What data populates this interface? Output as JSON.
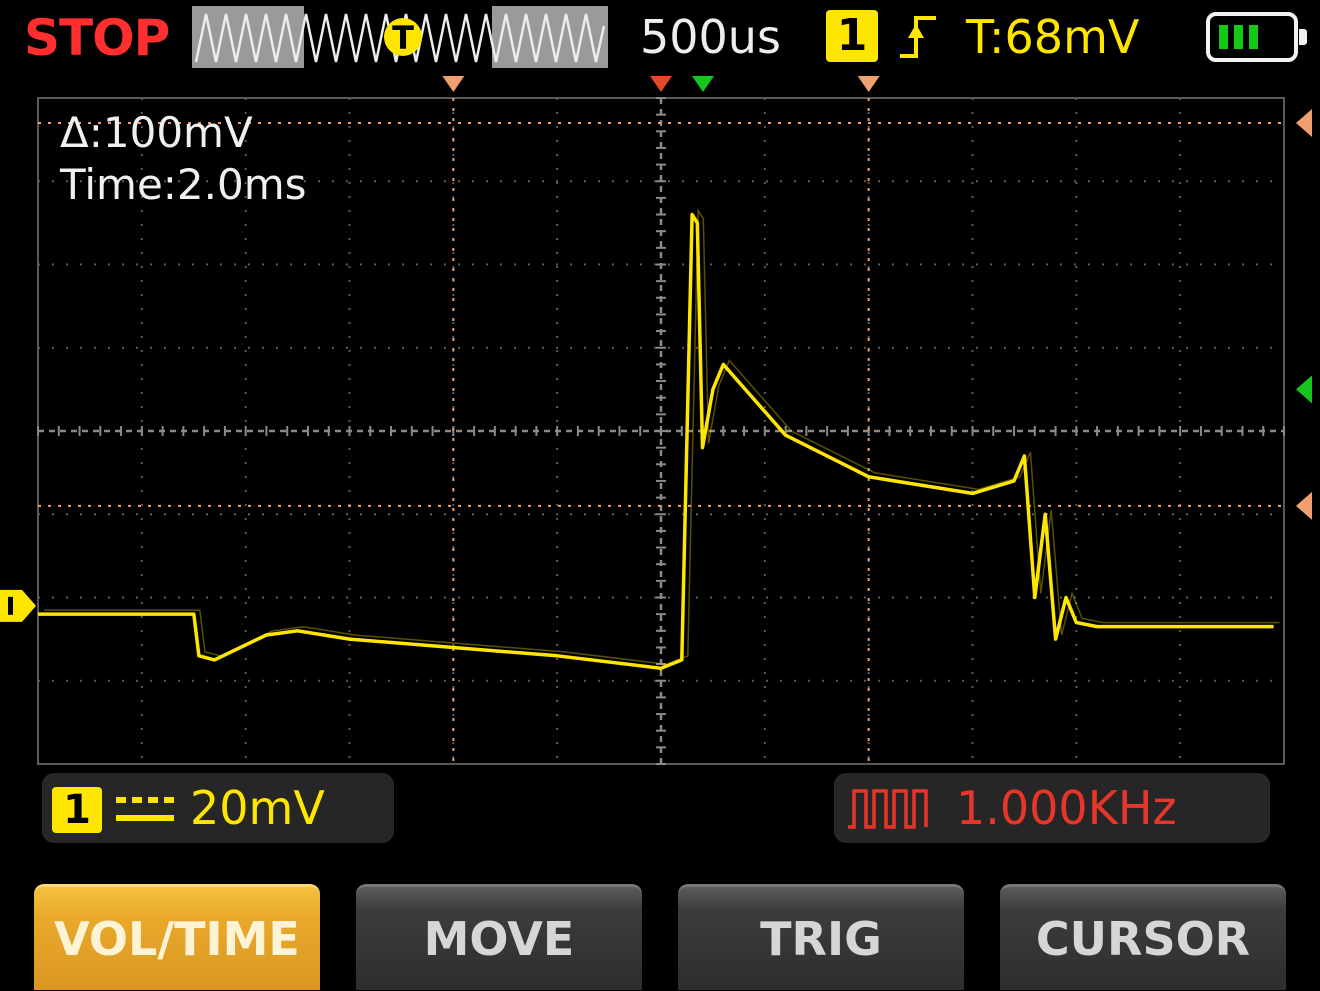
{
  "status": {
    "run_state": "STOP"
  },
  "overview": {
    "trigger_marker": "T"
  },
  "header": {
    "timebase": "500us",
    "channel": "1",
    "trigger_edge_icon": "rising-edge-icon",
    "trigger_level": "T:68mV",
    "battery_bars": 3
  },
  "readouts": {
    "delta": "Δ:100mV",
    "time": "Time:2.0ms"
  },
  "channel_info": {
    "channel": "1",
    "coupling_icon": "dc-coupling-icon",
    "volts_per_div": "20mV"
  },
  "frequency": {
    "icon": "square-wave-icon",
    "value": "1.000KHz"
  },
  "softkeys": [
    {
      "label": "VOL/TIME",
      "active": true
    },
    {
      "label": "MOVE",
      "active": false
    },
    {
      "label": "TRIG",
      "active": false
    },
    {
      "label": "CURSOR",
      "active": false
    }
  ],
  "colors": {
    "stop": "#ff2f2f",
    "channel1": "#ffe600",
    "cursor": "#f0a070",
    "trigger_pos": "#e04a2a",
    "center_marker": "#18c41e",
    "frequency": "#e8352a",
    "active_key": "#e9a92c"
  },
  "chart_data": {
    "type": "line",
    "x_divisions": 12,
    "y_divisions": 8,
    "grid": true,
    "series": [
      {
        "channel": "1",
        "x": [
          0,
          1.5,
          1.55,
          1.7,
          2.2,
          2.5,
          3,
          4,
          5,
          6,
          6.2,
          6.3,
          6.35,
          6.4,
          6.5,
          6.6,
          7.2,
          8,
          9,
          9.4,
          9.5,
          9.6,
          9.7,
          9.8,
          9.9,
          10,
          10.2,
          11,
          11.9
        ],
        "y": [
          -2.2,
          -2.2,
          -2.7,
          -2.75,
          -2.45,
          -2.4,
          -2.5,
          -2.6,
          -2.7,
          -2.85,
          -2.75,
          2.6,
          2.5,
          -0.2,
          0.5,
          0.8,
          -0.05,
          -0.55,
          -0.75,
          -0.6,
          -0.3,
          -2.0,
          -1.0,
          -2.5,
          -2.0,
          -2.3,
          -2.35,
          -2.35,
          -2.35
        ]
      }
    ],
    "cursors": {
      "vertical_div": [
        4,
        8
      ],
      "horizontal_div": [
        3.7,
        -0.9
      ],
      "trigger_position_div": 6,
      "channel_ground_div": -2.1
    }
  }
}
